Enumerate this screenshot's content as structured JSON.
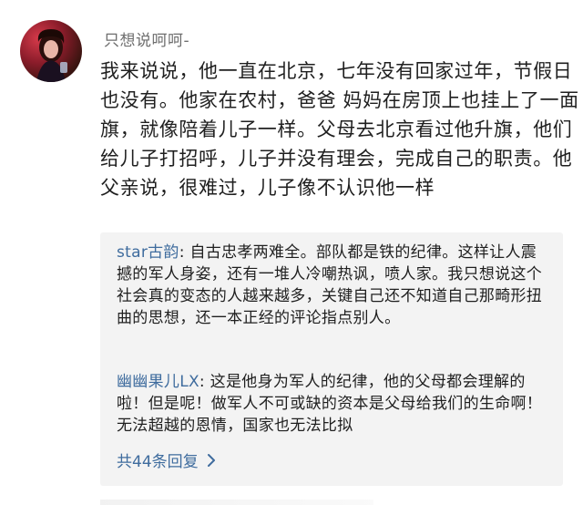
{
  "comment": {
    "username": "只想说呵呵-",
    "text": "我来说说，他一直在北京，七年没有回家过年，节假日也没有。他家在农村，爸爸 妈妈在房顶上也挂上了一面旗，就像陪着儿子一样。父母去北京看过他升旗，他们给儿子打招呼，儿子并没有理会，完成自己的职责。他父亲说，很难过，儿子像不认识他一样",
    "avatar_icon": "user-avatar"
  },
  "replies": [
    {
      "user": "star古韵",
      "separator": ": ",
      "text": "自古忠孝两难全。部队都是铁的纪律。这样让人震撼的军人身姿，还有一堆人冷嘲热讽，喷人家。我只想说这个社会真的变态的人越来越多，关键自己还不知道自己那畸形扭曲的思想，还一本正经的评论指点别人。"
    },
    {
      "user": "幽幽果儿LX",
      "separator": ": ",
      "text": "这是他身为军人的纪律，他的父母都会理解的啦！但是呢！做军人不可或缺的资本是父母给我们的生命啊！无法超越的恩情，国家也无法比拟"
    }
  ],
  "more_replies": {
    "label": "共44条回复",
    "icon": "chevron-right-icon"
  },
  "colors": {
    "link": "#3f6c9e",
    "text": "#1f1f1f",
    "username": "#6e6e6e",
    "reply_bg": "#f3f3f3"
  }
}
